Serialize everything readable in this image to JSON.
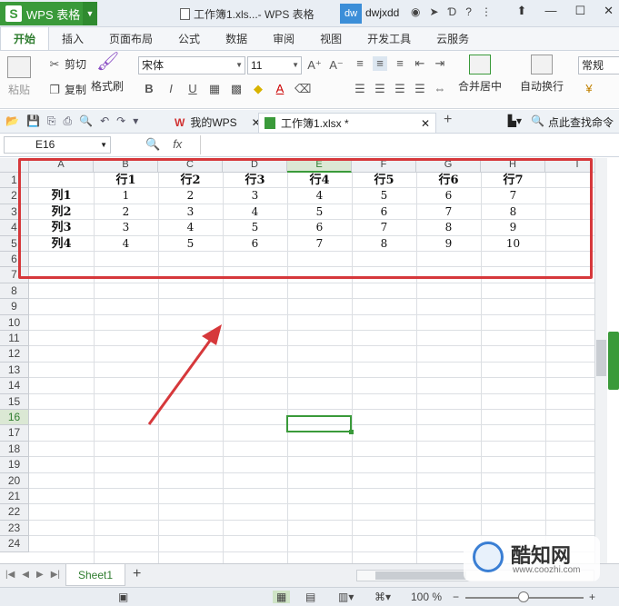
{
  "titlebar": {
    "app_name": "WPS 表格",
    "app_logo": "S",
    "doc_title": "工作簿1.xls...- WPS 表格",
    "avatar_text": "dw",
    "username": "dwjxdd",
    "help": "?"
  },
  "tabs": [
    "开始",
    "插入",
    "页面布局",
    "公式",
    "数据",
    "审阅",
    "视图",
    "开发工具",
    "云服务"
  ],
  "ribbon": {
    "paste": "粘贴",
    "cut": "剪切",
    "copy": "复制",
    "format_painter": "格式刷",
    "font_name": "宋体",
    "font_size": "11",
    "bold": "B",
    "italic": "I",
    "underline": "U",
    "merge_center": "合并居中",
    "wrap_text": "自动换行",
    "number_format": "常规"
  },
  "doc_tabs": {
    "my_wps": "我的WPS",
    "workbook": "工作簿1.xlsx *",
    "search_cmd": "点此查找命令"
  },
  "formula_bar": {
    "cell_ref": "E16",
    "fx_label": "fx",
    "value": ""
  },
  "columns": [
    "A",
    "B",
    "C",
    "D",
    "E",
    "F",
    "G",
    "H",
    "I"
  ],
  "rows": [
    "1",
    "2",
    "3",
    "4",
    "5",
    "6",
    "7",
    "8",
    "9",
    "10",
    "11",
    "12",
    "13",
    "14",
    "15",
    "16",
    "17",
    "18",
    "19",
    "20",
    "21",
    "22",
    "23",
    "24"
  ],
  "sheet": {
    "header_row": [
      "",
      "行1",
      "行2",
      "行3",
      "行4",
      "行5",
      "行6",
      "行7"
    ],
    "data": [
      [
        "列1",
        "1",
        "2",
        "3",
        "4",
        "5",
        "6",
        "7"
      ],
      [
        "列2",
        "2",
        "3",
        "4",
        "5",
        "6",
        "7",
        "8"
      ],
      [
        "列3",
        "3",
        "4",
        "5",
        "6",
        "7",
        "8",
        "9"
      ],
      [
        "列4",
        "4",
        "5",
        "6",
        "7",
        "8",
        "9",
        "10"
      ]
    ]
  },
  "sheet_tabs": [
    "Sheet1"
  ],
  "status": {
    "zoom": "100 %"
  },
  "watermark": {
    "title": "酷知网",
    "url": "www.coozhi.com"
  },
  "colors": {
    "brand_green": "#3a9a3a",
    "highlight_red": "#d6383b"
  }
}
